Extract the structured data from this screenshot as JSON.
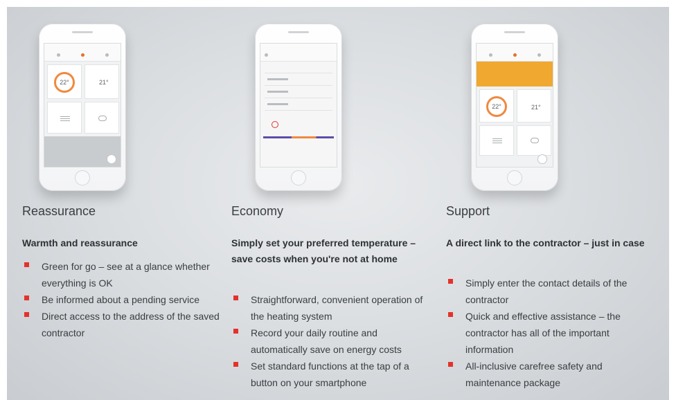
{
  "colors": {
    "bullet": "#e4322b",
    "accent_orange": "#f0893e",
    "banner_amber": "#f0a830"
  },
  "columns": [
    {
      "heading": "Reassurance",
      "subheading": "Warmth and reassurance",
      "phone": {
        "temp_main": "22°",
        "temp_secondary": "21°"
      },
      "bullets": [
        "Green for go – see at a glance whether everything is OK",
        "Be informed about a pending service",
        "Direct access to the address of the saved contractor"
      ]
    },
    {
      "heading": "Economy",
      "subheading": "Simply set your preferred temperature – save costs when you're not at home",
      "bullets": [
        "Straightforward, convenient operation of the heating system",
        "Record your daily routine and automatically save on energy costs",
        "Set standard functions at the tap of a button on your smartphone"
      ]
    },
    {
      "heading": "Support",
      "subheading": "A direct link to the contractor – just in case",
      "phone": {
        "temp_main": "22°",
        "temp_secondary": "21°"
      },
      "bullets": [
        "Simply enter the contact details of the contractor",
        "Quick and effective assistance – the contractor has all of the important information",
        "All-inclusive carefree safety and maintenance package"
      ]
    }
  ]
}
